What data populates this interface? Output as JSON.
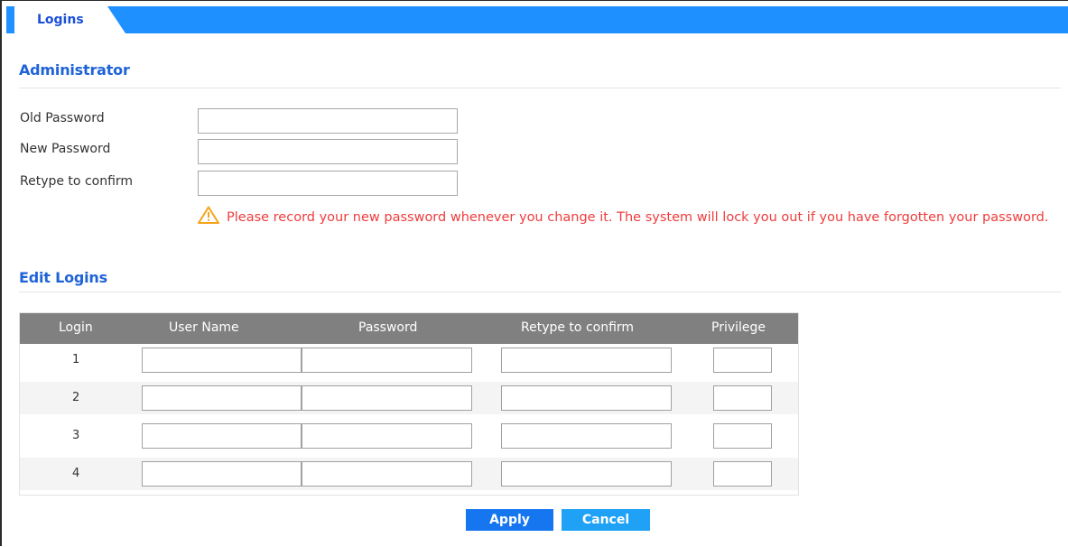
{
  "tab": {
    "label": "Logins"
  },
  "administrator": {
    "title": "Administrator",
    "old_password_label": "Old Password",
    "new_password_label": "New Password",
    "retype_label": "Retype to confirm",
    "old_password_value": "",
    "new_password_value": "",
    "retype_value": "",
    "warning_icon": "warning-triangle-icon",
    "warning_text": "Please record your new password whenever you change it. The system will lock you out if you have forgotten your password."
  },
  "edit_logins": {
    "title": "Edit Logins",
    "columns": [
      "Login",
      "User Name",
      "Password",
      "Retype to confirm",
      "Privilege"
    ],
    "rows": [
      {
        "login": "1",
        "user_name": "",
        "password": "",
        "retype": "",
        "privilege": ""
      },
      {
        "login": "2",
        "user_name": "",
        "password": "",
        "retype": "",
        "privilege": ""
      },
      {
        "login": "3",
        "user_name": "",
        "password": "",
        "retype": "",
        "privilege": ""
      },
      {
        "login": "4",
        "user_name": "",
        "password": "",
        "retype": "",
        "privilege": ""
      }
    ]
  },
  "buttons": {
    "apply": "Apply",
    "cancel": "Cancel"
  },
  "colors": {
    "accent_blue": "#1e90ff",
    "title_blue": "#1f63d8",
    "warning_red": "#f03c3c",
    "header_gray": "#808080",
    "apply_blue": "#1576f0",
    "cancel_blue": "#1fa2f5"
  }
}
